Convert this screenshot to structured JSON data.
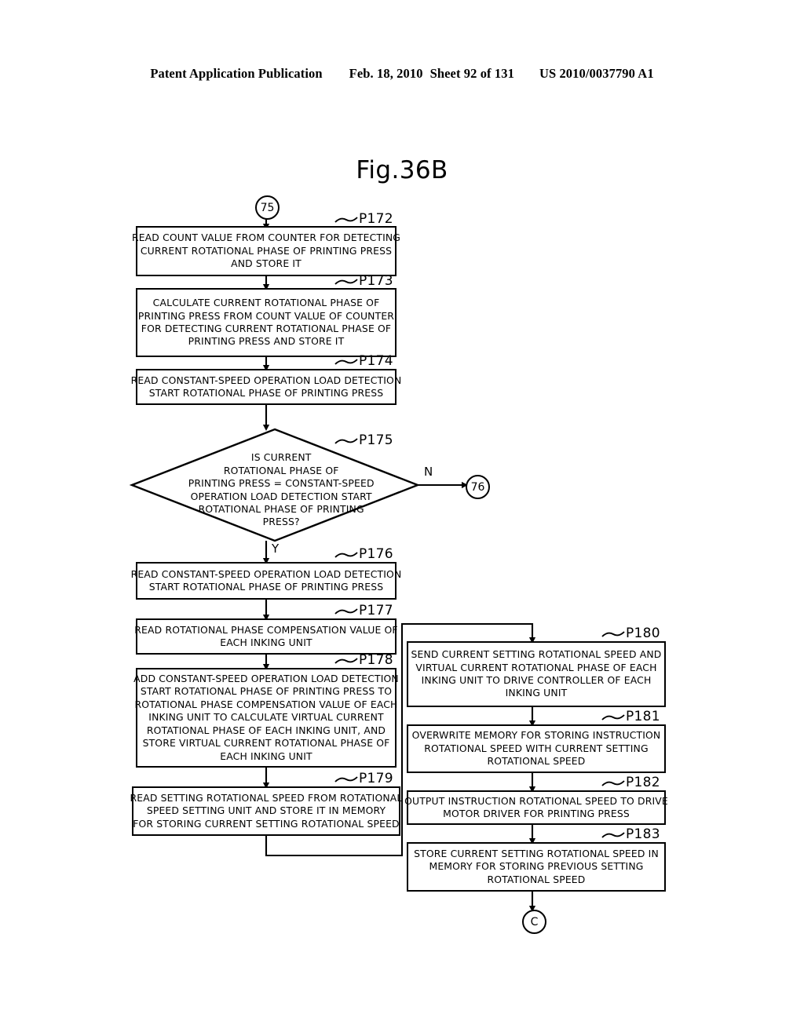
{
  "header": {
    "publication": "Patent Application Publication",
    "date": "Feb. 18, 2010",
    "sheet": "Sheet 92 of 131",
    "patent_number": "US 2010/0037790 A1"
  },
  "figure": {
    "title": "Fig.36B"
  },
  "connectors": {
    "entry_top": "75",
    "exit_no": "76",
    "exit_bottom": "C"
  },
  "branch_labels": {
    "no": "N",
    "yes": "Y"
  },
  "steps": {
    "p172": {
      "tag": "P172",
      "lines": [
        "READ COUNT VALUE FROM COUNTER FOR DETECTING",
        "CURRENT ROTATIONAL PHASE OF PRINTING PRESS",
        "AND STORE IT"
      ]
    },
    "p173": {
      "tag": "P173",
      "lines": [
        "CALCULATE CURRENT ROTATIONAL PHASE OF",
        "PRINTING PRESS FROM COUNT VALUE OF COUNTER",
        "FOR DETECTING CURRENT ROTATIONAL PHASE OF",
        "PRINTING PRESS AND STORE IT"
      ]
    },
    "p174": {
      "tag": "P174",
      "lines": [
        "READ CONSTANT-SPEED OPERATION LOAD DETECTION",
        "START ROTATIONAL PHASE OF PRINTING PRESS"
      ]
    },
    "p175": {
      "tag": "P175",
      "lines": [
        "IS CURRENT",
        "ROTATIONAL PHASE OF",
        "PRINTING PRESS = CONSTANT-SPEED",
        "OPERATION LOAD DETECTION START",
        "ROTATIONAL PHASE OF PRINTING",
        "PRESS?"
      ]
    },
    "p176": {
      "tag": "P176",
      "lines": [
        "READ CONSTANT-SPEED OPERATION LOAD DETECTION",
        "START ROTATIONAL PHASE OF PRINTING PRESS"
      ]
    },
    "p177": {
      "tag": "P177",
      "lines": [
        "READ ROTATIONAL PHASE COMPENSATION VALUE OF",
        "EACH INKING UNIT"
      ]
    },
    "p178": {
      "tag": "P178",
      "lines": [
        "ADD CONSTANT-SPEED OPERATION LOAD DETECTION",
        "START ROTATIONAL PHASE OF PRINTING PRESS TO",
        "ROTATIONAL PHASE COMPENSATION VALUE OF EACH",
        "INKING UNIT TO CALCULATE VIRTUAL CURRENT",
        "ROTATIONAL PHASE OF EACH INKING UNIT, AND",
        "STORE VIRTUAL CURRENT ROTATIONAL PHASE OF",
        "EACH INKING UNIT"
      ]
    },
    "p179": {
      "tag": "P179",
      "lines": [
        "READ SETTING ROTATIONAL SPEED FROM ROTATIONAL",
        "SPEED SETTING UNIT AND STORE IT IN MEMORY",
        "FOR STORING CURRENT SETTING ROTATIONAL SPEED"
      ]
    },
    "p180": {
      "tag": "P180",
      "lines": [
        "SEND CURRENT SETTING ROTATIONAL SPEED AND",
        "VIRTUAL CURRENT ROTATIONAL PHASE OF EACH",
        "INKING UNIT TO DRIVE CONTROLLER OF EACH",
        "INKING UNIT"
      ]
    },
    "p181": {
      "tag": "P181",
      "lines": [
        "OVERWRITE MEMORY FOR STORING INSTRUCTION",
        "ROTATIONAL SPEED WITH CURRENT SETTING",
        "ROTATIONAL SPEED"
      ]
    },
    "p182": {
      "tag": "P182",
      "lines": [
        "OUTPUT INSTRUCTION ROTATIONAL SPEED TO DRIVE",
        "MOTOR DRIVER FOR PRINTING PRESS"
      ]
    },
    "p183": {
      "tag": "P183",
      "lines": [
        "STORE CURRENT SETTING ROTATIONAL SPEED IN",
        "MEMORY FOR STORING PREVIOUS SETTING",
        "ROTATIONAL SPEED"
      ]
    }
  }
}
